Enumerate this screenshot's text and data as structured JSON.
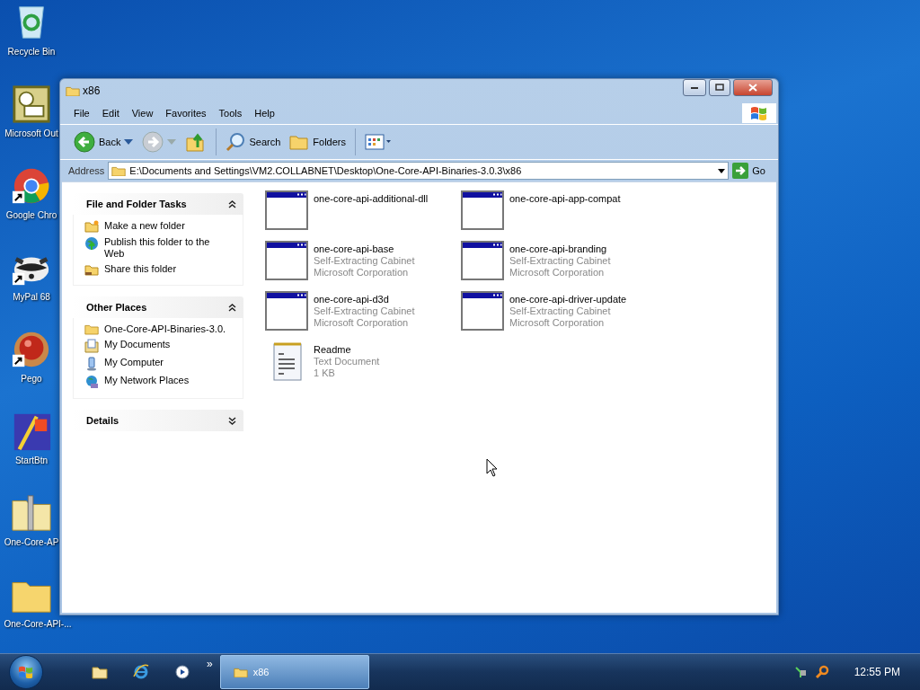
{
  "desktop": {
    "icons": [
      {
        "label": "Recycle Bin",
        "kind": "recycle",
        "shortcut": false
      },
      {
        "label": "Microsoft Out",
        "kind": "outlook",
        "shortcut": false
      },
      {
        "label": "Google Chro",
        "kind": "chrome",
        "shortcut": true
      },
      {
        "label": "MyPal 68",
        "kind": "raccoon",
        "shortcut": true
      },
      {
        "label": "Pego",
        "kind": "ball",
        "shortcut": true
      },
      {
        "label": "StartBtn",
        "kind": "startbtn",
        "shortcut": false
      },
      {
        "label": "One-Core-AP",
        "kind": "zip",
        "shortcut": false
      },
      {
        "label": "One-Core-API-...",
        "kind": "folder",
        "shortcut": false
      }
    ]
  },
  "window": {
    "title": "x86",
    "menu": [
      "File",
      "Edit",
      "View",
      "Favorites",
      "Tools",
      "Help"
    ],
    "toolbar": [
      {
        "label": "Back",
        "kind": "back"
      },
      {
        "kind": "forward"
      },
      {
        "kind": "up"
      },
      {
        "label": "Search",
        "kind": "search"
      },
      {
        "label": "Folders",
        "kind": "folders"
      },
      {
        "kind": "views"
      }
    ],
    "address": {
      "label": "Address",
      "value": "E:\\Documents and Settings\\VM2.COLLABNET\\Desktop\\One-Core-API-Binaries-3.0.3\\x86",
      "go": "Go"
    },
    "panels": [
      {
        "title": "File and Folder Tasks",
        "expanded": true,
        "items": [
          {
            "label": "Make a new folder",
            "kind": "newfolder"
          },
          {
            "label": "Publish this folder to the Web",
            "kind": "globe"
          },
          {
            "label": "Share this folder",
            "kind": "share"
          }
        ]
      },
      {
        "title": "Other Places",
        "expanded": true,
        "items": [
          {
            "label": "One-Core-API-Binaries-3.0.",
            "kind": "folder"
          },
          {
            "label": "My Documents",
            "kind": "documents"
          },
          {
            "label": "My Computer",
            "kind": "computer"
          },
          {
            "label": "My Network Places",
            "kind": "network"
          }
        ]
      },
      {
        "title": "Details",
        "expanded": false
      }
    ],
    "files": [
      {
        "name": "one-core-api-additional-dll",
        "kind": "exe"
      },
      {
        "name": "one-core-api-app-compat",
        "kind": "exe"
      },
      {
        "name": "one-core-api-base",
        "type": "Self-Extracting Cabinet",
        "detail": "Microsoft Corporation",
        "kind": "exe"
      },
      {
        "name": "one-core-api-branding",
        "type": "Self-Extracting Cabinet",
        "detail": "Microsoft Corporation",
        "kind": "exe"
      },
      {
        "name": "one-core-api-d3d",
        "type": "Self-Extracting Cabinet",
        "detail": "Microsoft Corporation",
        "kind": "exe"
      },
      {
        "name": "one-core-api-driver-update",
        "type": "Self-Extracting Cabinet",
        "detail": "Microsoft Corporation",
        "kind": "exe"
      },
      {
        "name": "Readme",
        "type": "Text Document",
        "detail": "1 KB",
        "kind": "text"
      }
    ]
  },
  "taskbar": {
    "quicklaunch": [
      {
        "kind": "explorer"
      },
      {
        "kind": "ie"
      },
      {
        "kind": "media"
      }
    ],
    "more": "»",
    "tasks": [
      {
        "label": "x86",
        "selected": true
      }
    ],
    "clock": "12:55 PM"
  }
}
